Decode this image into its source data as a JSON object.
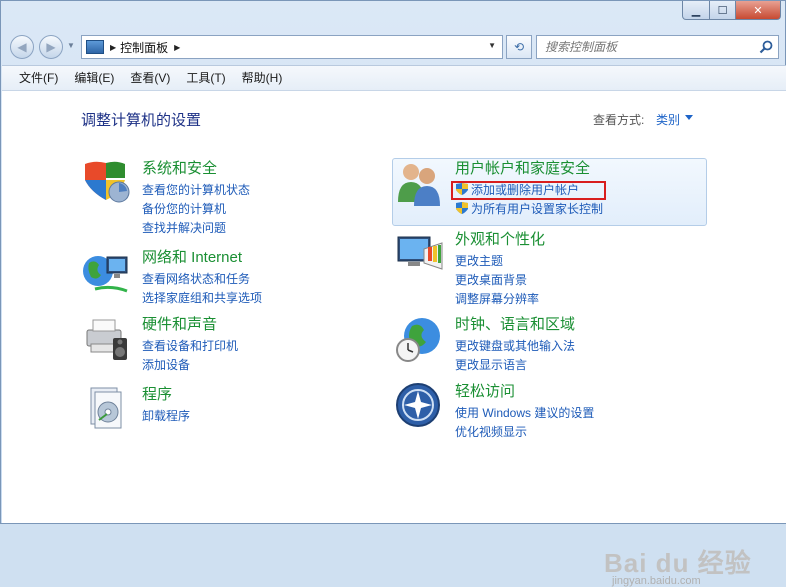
{
  "window": {
    "min_glyph": "▁",
    "max_glyph": "☐",
    "close_glyph": "✕"
  },
  "nav": {
    "back_glyph": "◀",
    "forward_glyph": "▶",
    "breadcrumb_root_arrow": "▶",
    "breadcrumb": "控制面板",
    "breadcrumb_arrow": "▶",
    "dropdown_glyph": "▼",
    "refresh_glyph": "⟲"
  },
  "search": {
    "placeholder": "搜索控制面板"
  },
  "menu": [
    "文件(F)",
    "编辑(E)",
    "查看(V)",
    "工具(T)",
    "帮助(H)"
  ],
  "main": {
    "title": "调整计算机的设置",
    "view_by_label": "查看方式:",
    "view_by_value": "类别"
  },
  "categories_left": [
    {
      "title": "系统和安全",
      "icon": "system-security-icon",
      "links": [
        "查看您的计算机状态",
        "备份您的计算机",
        "查找并解决问题"
      ]
    },
    {
      "title": "网络和 Internet",
      "icon": "network-internet-icon",
      "links": [
        "查看网络状态和任务",
        "选择家庭组和共享选项"
      ]
    },
    {
      "title": "硬件和声音",
      "icon": "hardware-sound-icon",
      "links": [
        "查看设备和打印机",
        "添加设备"
      ]
    },
    {
      "title": "程序",
      "icon": "programs-icon",
      "links": [
        "卸载程序"
      ]
    }
  ],
  "categories_right": [
    {
      "title": "用户帐户和家庭安全",
      "icon": "user-accounts-icon",
      "links": [
        "添加或删除用户帐户",
        "为所有用户设置家长控制"
      ]
    },
    {
      "title": "外观和个性化",
      "icon": "appearance-icon",
      "links": [
        "更改主题",
        "更改桌面背景",
        "调整屏幕分辨率"
      ]
    },
    {
      "title": "时钟、语言和区域",
      "icon": "clock-language-icon",
      "links": [
        "更改键盘或其他输入法",
        "更改显示语言"
      ]
    },
    {
      "title": "轻松访问",
      "icon": "ease-of-access-icon",
      "links": [
        "使用 Windows 建议的设置",
        "优化视频显示"
      ]
    }
  ],
  "watermark": {
    "main": "Bai du 经验",
    "url": "jingyan.baidu.com"
  },
  "colors": {
    "category_title": "#1a8f33",
    "link": "#1e5bb8",
    "page_title": "#1e3287",
    "highlight_border": "#d81e1e"
  }
}
